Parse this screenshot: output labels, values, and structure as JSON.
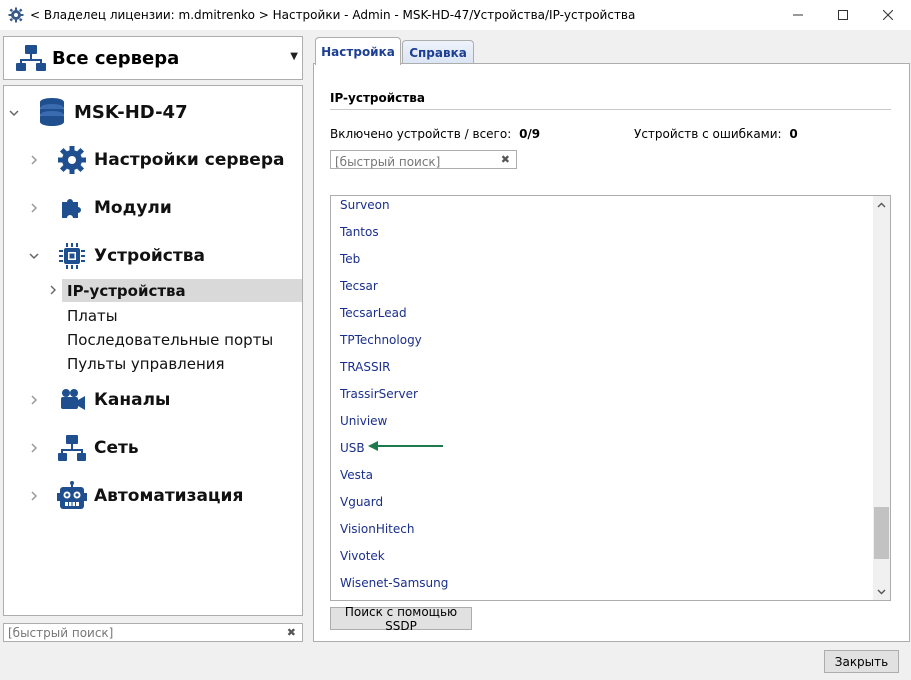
{
  "window": {
    "title": "< Владелец лицензии: m.dmitrenko > Настройки - Admin - MSK-HD-47/Устройства/IP-устройства",
    "icon": "gear-icon",
    "minimize": "—",
    "maximize": "☐",
    "close": "✕"
  },
  "server_select": {
    "label": "Все сервера",
    "icon": "network-servers-icon"
  },
  "tree": {
    "root": {
      "label": "MSK-HD-47",
      "icon": "database-icon",
      "expanded": true
    },
    "items": [
      {
        "label": "Настройки сервера",
        "icon": "gear-icon",
        "expanded": false
      },
      {
        "label": "Модули",
        "icon": "puzzle-icon",
        "expanded": false
      },
      {
        "label": "Устройства",
        "icon": "chip-icon",
        "expanded": true
      },
      {
        "label": "Каналы",
        "icon": "camera-icon",
        "expanded": false
      },
      {
        "label": "Сеть",
        "icon": "network-icon",
        "expanded": false
      },
      {
        "label": "Автоматизация",
        "icon": "robot-icon",
        "expanded": false
      }
    ],
    "device_children": [
      {
        "label": "IP-устройства",
        "selected": true
      },
      {
        "label": "Платы",
        "selected": false
      },
      {
        "label": "Последовательные порты",
        "selected": false
      },
      {
        "label": "Пульты управления",
        "selected": false
      }
    ]
  },
  "left_search": {
    "placeholder": "[быстрый поиск]",
    "clear": "✖"
  },
  "tabs": [
    {
      "label": "Настройка",
      "active": true
    },
    {
      "label": "Справка",
      "active": false
    }
  ],
  "main": {
    "section_title": "IP-устройства",
    "enabled_label": "Включено устройств / всего:",
    "enabled_value": "0/9",
    "errors_label": "Устройств с ошибками:",
    "errors_value": "0",
    "search_placeholder": "[быстрый поиск]",
    "search_clear": "✖",
    "vendors": [
      "Surveon",
      "Tantos",
      "Teb",
      "Tecsar",
      "TecsarLead",
      "TPTechnology",
      "TRASSIR",
      "TrassirServer",
      "Uniview",
      "USB",
      "Vesta",
      "Vguard",
      "VisionHitech",
      "Vivotek",
      "Wisenet-Samsung"
    ],
    "highlighted_vendor": "USB",
    "arrow_color": "#1e7a4c",
    "scroll_up": "▲",
    "scroll_down": "▼",
    "ssdp_button": "Поиск с помощью SSDP"
  },
  "footer": {
    "close_button": "Закрыть"
  },
  "colors": {
    "link": "#1a2f8a",
    "tab_text": "#1c3f94",
    "selection": "#d9d9d9"
  }
}
